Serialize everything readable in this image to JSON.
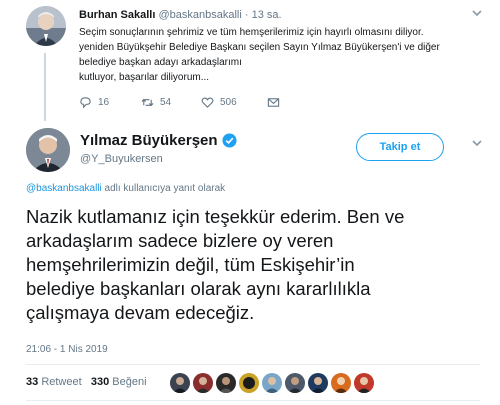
{
  "parent_tweet": {
    "name": "Burhan Sakallı",
    "handle": "@baskanbsakalli",
    "separator": "·",
    "time": "13 sa.",
    "text_lines": [
      "Seçim sonuçlarının şehrimiz ve tüm hemşerilerimiz için hayırlı olmasını diliyor.",
      "yeniden Büyükşehir Belediye Başkanı seçilen Sayın Yılmaz Büyükerşen'i ve diğer",
      "belediye başkan adayı arkadaşlarımı",
      "kutluyor, başarılar diliyorum..."
    ],
    "reply_count": "16",
    "retweet_count": "54",
    "like_count": "506",
    "icons": {
      "reply": "reply-icon",
      "retweet": "retweet-icon",
      "like": "heart-icon",
      "dm": "envelope-icon",
      "menu": "chevron-down-icon"
    }
  },
  "main_tweet": {
    "name": "Yılmaz Büyükerşen",
    "handle": "@Y_Buyukersen",
    "follow_label": "Takip et",
    "reply_mention": "@baskanbsakalli",
    "reply_suffix": " adlı kullanıcıya yanıt olarak",
    "text_lines": [
      "Nazik kutlamanız için teşekkür ederim. Ben ve",
      "arkadaşlarım sadece bizlere oy veren",
      "hemşehrilerimizin değil, tüm Eskişehir’in",
      "belediye başkanları olarak aynı kararlılıkla",
      "çalışmaya devam edeceğiz."
    ],
    "timestamp": "21:06 - 1 Nis 2019",
    "retweet_count": "33",
    "retweet_label": "Retweet",
    "like_count": "330",
    "like_label": "Beğeni",
    "icons": {
      "verified": "verified-badge-icon",
      "menu": "chevron-down-icon"
    }
  },
  "colors": {
    "accent": "#1da1f2",
    "mention": "#1b95e0",
    "secondary_text": "#657786",
    "divider": "#e6ecf0"
  }
}
